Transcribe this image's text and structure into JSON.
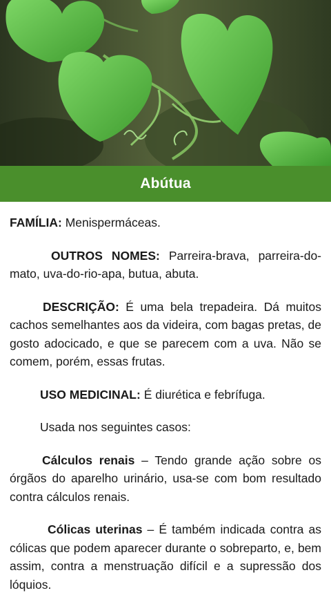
{
  "header": {
    "title": "Abútua"
  },
  "sections": {
    "familia": {
      "label": "FAMÍLIA:",
      "text": " Menispermáceas."
    },
    "outros_nomes": {
      "label": "OUTROS NOMES:",
      "text": " Parreira-brava, parreira-do-mato, uva-do-rio-apa, butua, abuta."
    },
    "descricao": {
      "label": "DESCRIÇÃO:",
      "text": " É uma bela trepadeira. Dá muitos cachos semelhantes aos da videira, com bagas pretas, de gosto adocicado, e que se parecem com a uva. Não se comem, porém, essas frutas."
    },
    "uso_medicinal": {
      "label": "USO MEDICINAL:",
      "text": " É diurética e febrífuga."
    },
    "usada": {
      "text": "Usada nos seguintes casos:"
    },
    "calculos": {
      "label": "Cálculos renais",
      "text": " – Tendo grande ação sobre os órgãos do aparelho urinário, usa-se com bom resultado contra cálculos renais."
    },
    "colicas": {
      "label": "Cólicas uterinas",
      "text": " – É também indicada contra as cólicas que podem aparecer durante o sobreparto, e, bem assim, contra a menstruação difícil e a supressão dos lóquios."
    }
  },
  "colors": {
    "title_bar": "#4a8f2c",
    "leaf": "#5fc24a"
  }
}
